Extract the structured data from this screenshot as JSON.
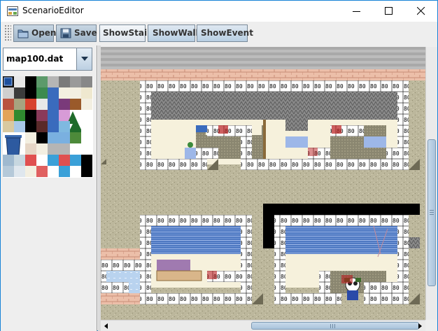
{
  "window": {
    "title": "ScenarioEditor",
    "controls": {
      "minimize": "minimize-icon",
      "maximize": "maximize-icon",
      "close": "close-icon"
    }
  },
  "toolbar": {
    "open_label": "Open",
    "save_label": "Save",
    "show_stair_label": "ShowStair",
    "show_wall_label": "ShowWall",
    "show_event_label": "ShowEvent"
  },
  "map_selector": {
    "selected": "map100.dat"
  },
  "map": {
    "tile_label": "80"
  },
  "colors": {
    "accent": "#1883d7",
    "button_face": "#c4d6e8",
    "grass": "#bcb79c",
    "roof": "#8c8c8c",
    "water": "#5a83c6",
    "floor": "#f7f3df",
    "brick": "#e9b9a5",
    "black": "#000000"
  }
}
